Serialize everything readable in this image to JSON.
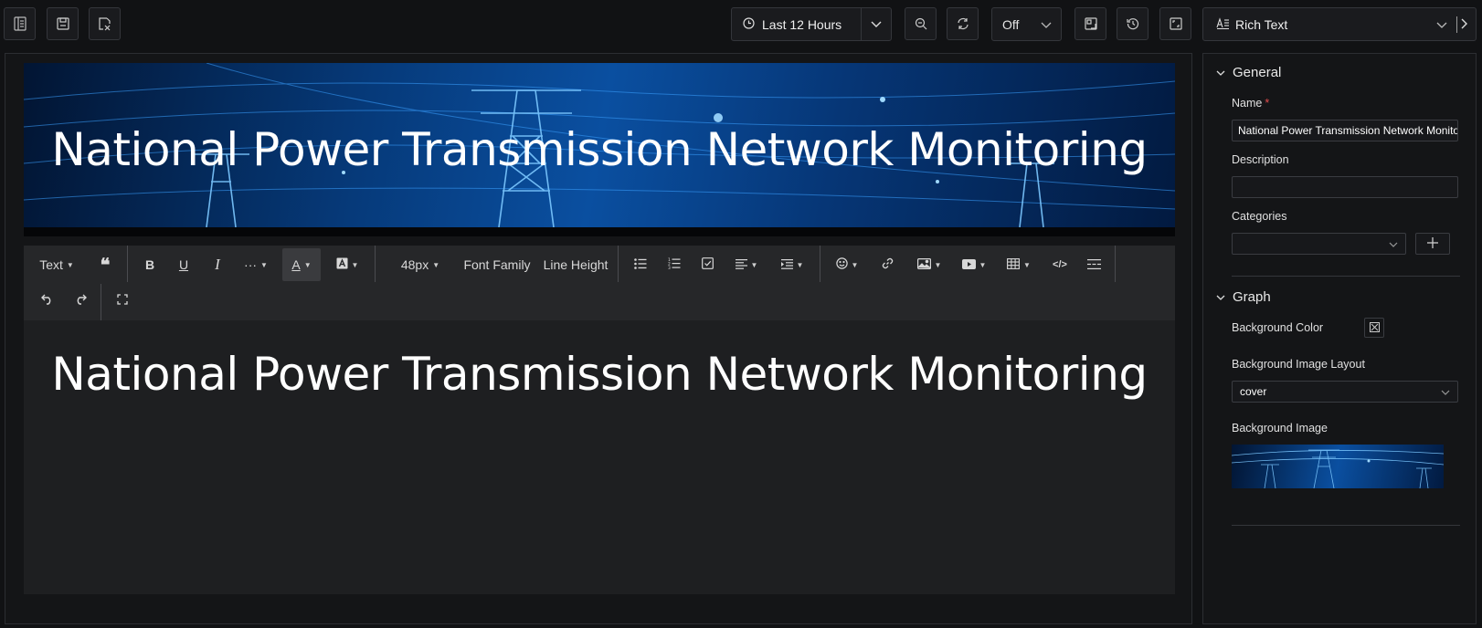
{
  "toolbar": {
    "buttons": [
      "panel-list-icon",
      "save-icon",
      "discard-icon",
      "zoom-out-icon",
      "refresh-icon",
      "panel-mode-icon",
      "history-icon",
      "fullscreen-icon"
    ],
    "time_range": "Last 12 Hours",
    "refresh_interval": "Off",
    "panel_type": "Rich Text"
  },
  "editor": {
    "banner_title": "National Power Transmission Network Monitoring",
    "toolbar": {
      "text_style": "Text",
      "font_size": "48px",
      "font_family": "Font Family",
      "line_height": "Line Height",
      "icons": [
        "quote-icon",
        "bold-icon",
        "underline-icon",
        "italic-icon",
        "more-icon",
        "font-color-icon",
        "background-color-icon",
        "bullet-list-icon",
        "numbered-list-icon",
        "task-list-icon",
        "align-icon",
        "indent-icon",
        "emoji-icon",
        "link-icon",
        "image-icon",
        "video-icon",
        "table-icon",
        "code-icon",
        "divider-icon",
        "undo-icon",
        "redo-icon",
        "fullscreen-icon"
      ]
    },
    "content_heading": "National Power Transmission Network Monitoring"
  },
  "properties": {
    "general": {
      "header": "General",
      "name_label": "Name",
      "name_required": "*",
      "name_value": "National Power Transmission Network Monitoring",
      "description_label": "Description",
      "description_value": "",
      "categories_label": "Categories",
      "categories_value": ""
    },
    "graph": {
      "header": "Graph",
      "bg_color_label": "Background Color",
      "bg_layout_label": "Background Image Layout",
      "bg_layout_value": "cover",
      "bg_image_label": "Background Image"
    }
  },
  "colors": {
    "background": "#111214",
    "panel": "#141517",
    "toolbar": "#262729",
    "banner_blue": "#0a4fa0",
    "required": "#e34d4d"
  }
}
